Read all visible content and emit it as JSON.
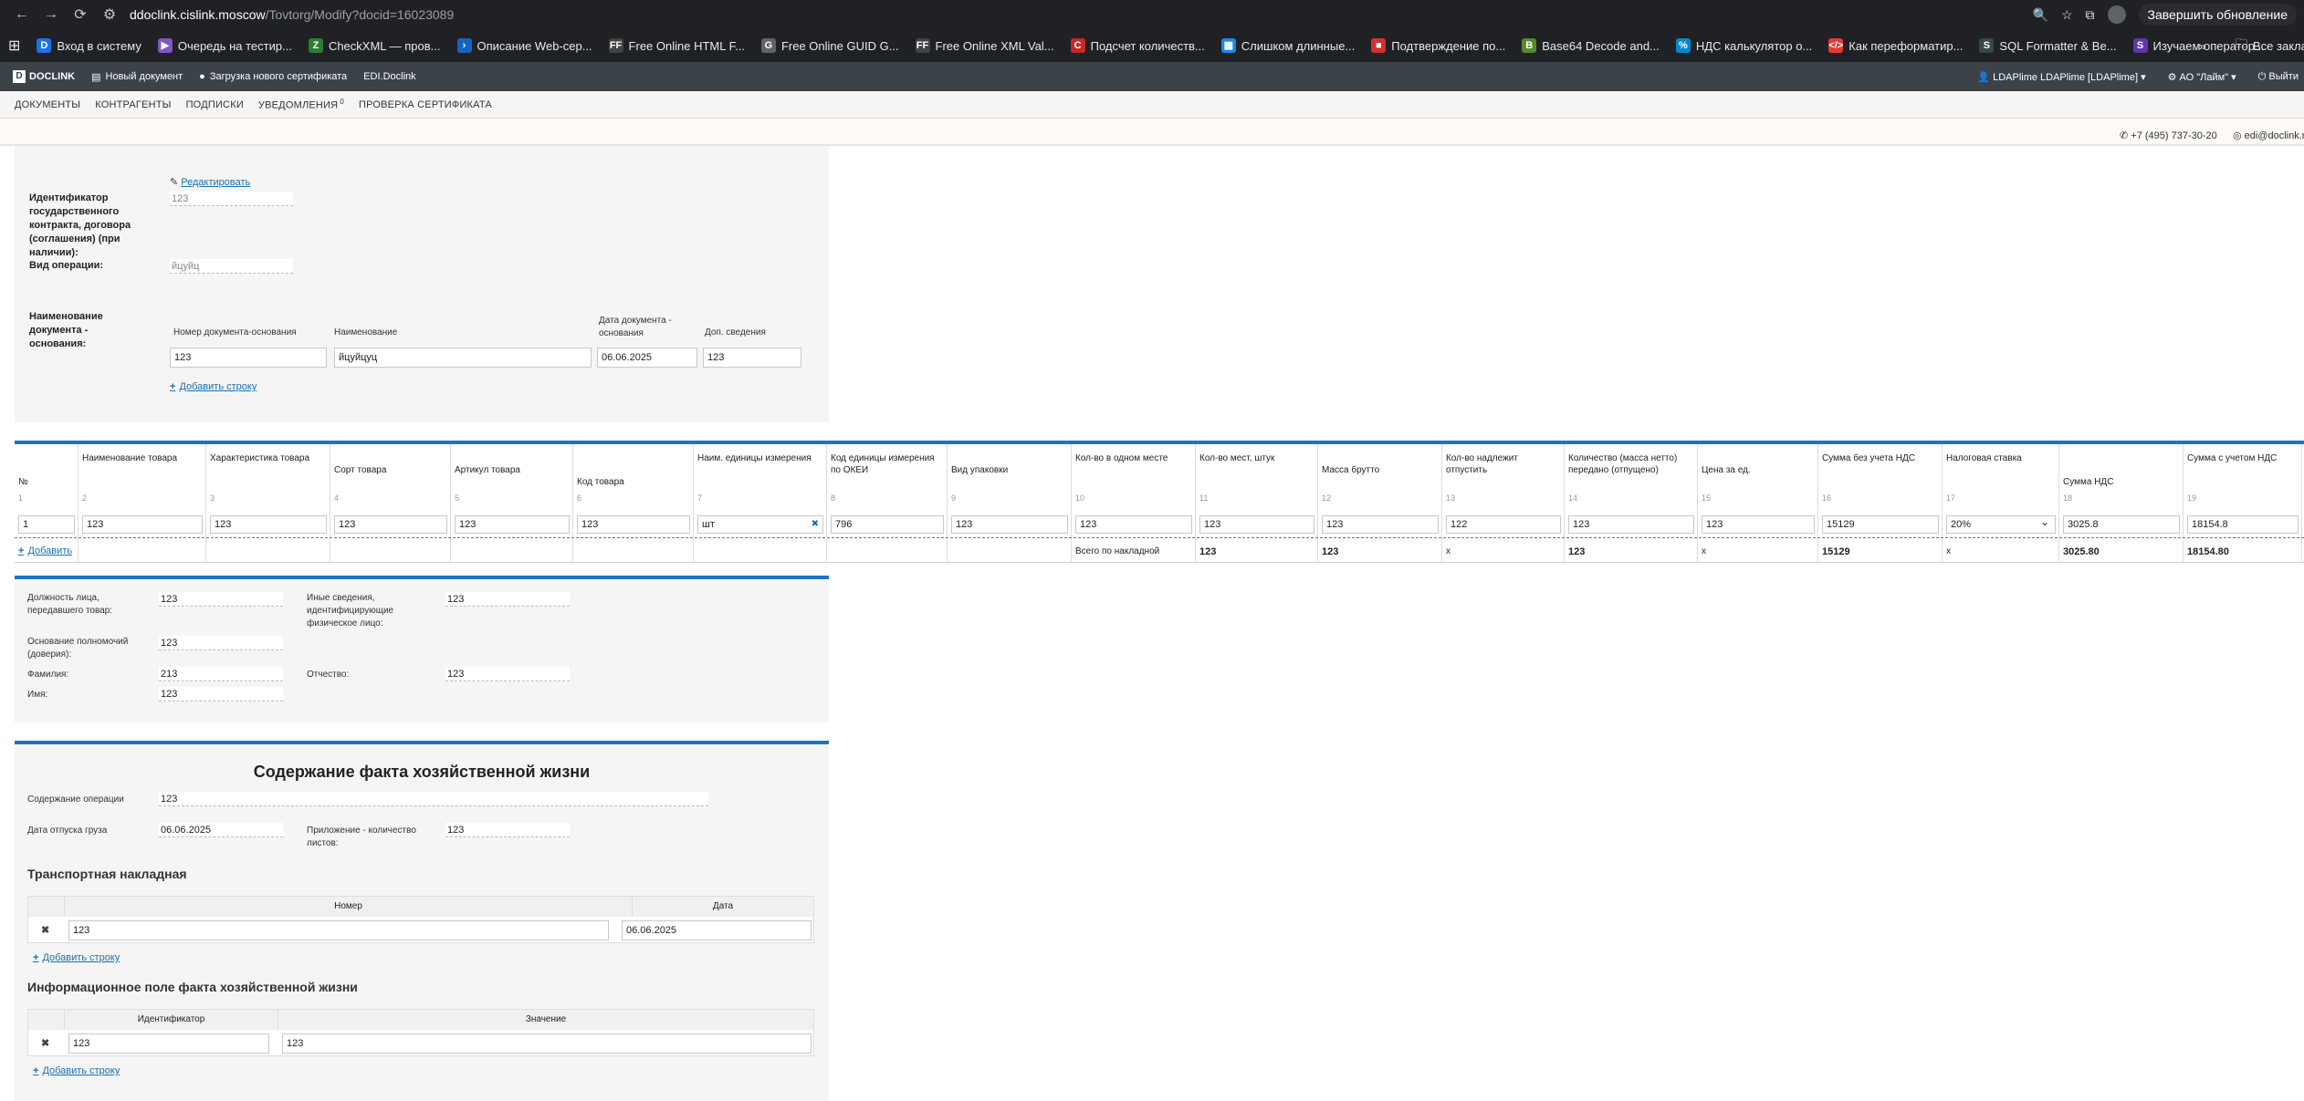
{
  "browser": {
    "url_host": "ddoclink.cislink.moscow",
    "url_path": "/Tovtorg/Modify?docid=16023089",
    "update_label": "Завершить обновление",
    "all_bookmarks_label": "Все закла",
    "bookmarks": [
      {
        "label": "Вход в систему",
        "color": "#1a73e8",
        "glyph": "D"
      },
      {
        "label": "Очередь на тестир...",
        "color": "#7e57c2",
        "glyph": "▶"
      },
      {
        "label": "CheckXML — пров...",
        "color": "#2e7d32",
        "glyph": "Z"
      },
      {
        "label": "Описание Web-сер...",
        "color": "#1565c0",
        "glyph": "›"
      },
      {
        "label": "Free Online HTML F...",
        "color": "#424242",
        "glyph": "FF"
      },
      {
        "label": "Free Online GUID G...",
        "color": "#5f6368",
        "glyph": "G"
      },
      {
        "label": "Free Online XML Val...",
        "color": "#424242",
        "glyph": "FF"
      },
      {
        "label": "Подсчет количеств...",
        "color": "#c62828",
        "glyph": "C"
      },
      {
        "label": "Слишком длинные...",
        "color": "#1e88e5",
        "glyph": "▦"
      },
      {
        "label": "Подтверждение по...",
        "color": "#d32f2f",
        "glyph": "■"
      },
      {
        "label": "Base64 Decode and...",
        "color": "#558b2f",
        "glyph": "B"
      },
      {
        "label": "НДС калькулятор о...",
        "color": "#0288d1",
        "glyph": "%"
      },
      {
        "label": "Как переформатир...",
        "color": "#e53935",
        "glyph": "</>"
      },
      {
        "label": "SQL Formatter & Be...",
        "color": "#37474f",
        "glyph": "S"
      },
      {
        "label": "Изучаем оператор...",
        "color": "#5e35b1",
        "glyph": "S"
      }
    ]
  },
  "header": {
    "logo": "DOCLINK",
    "new_doc": "Новый документ",
    "load_cert": "Загрузка нового сертификата",
    "edi": "EDI.Doclink",
    "user": "LDAPlime LDAPlime [LDAPlime]",
    "org": "АО \"Лайм\"",
    "exit": "Выйти"
  },
  "menu": {
    "documents": "ДОКУМЕНТЫ",
    "contractors": "КОНТРАГЕНТЫ",
    "subscriptions": "ПОДПИСКИ",
    "notifications": "УВЕДОМЛЕНИЯ",
    "notifications_count": "0",
    "check_cert": "ПРОВЕРКА СЕРТИФИКАТА"
  },
  "contacts": {
    "phone": "+7 (495) 737-30-20",
    "email": "edi@doclink.ru"
  },
  "top_section": {
    "edit_link": "Редактировать",
    "gov_contract_label": "Идентификатор государственного контракта, договора (соглашения) (при наличии):",
    "gov_contract_value": "123",
    "operation_type_label": "Вид операции:",
    "operation_type_value": "йцуйц",
    "basis_label": "Наименование документа - основания:",
    "basis_headers": [
      "Номер документа-основания",
      "Наименование",
      "Дата документа - основания",
      "Доп. сведения"
    ],
    "basis_values": [
      "123",
      "йцуйцуц",
      "06.06.2025",
      "123"
    ],
    "add_row": "Добавить строку"
  },
  "goods": {
    "headers": [
      "№",
      "Наименование товара",
      "Характеристика товара",
      "Сорт товара",
      "Артикул товара",
      "Код товара",
      "Наим. единицы измерения",
      "Код единицы измерения по ОКЕИ",
      "Вид упаковки",
      "Кол-во в одном месте",
      "Кол-во мест, штук",
      "Масса брутто",
      "Кол-во надлежит отпустить",
      "Количество (масса нетто) передано (отпущено)",
      "Цена за ед.",
      "Сумма без учета НДС",
      "Налоговая ставка",
      "Сумма НДС",
      "Сумма с учетом НДС"
    ],
    "numbers": [
      "1",
      "2",
      "3",
      "4",
      "5",
      "6",
      "7",
      "8",
      "9",
      "10",
      "11",
      "12",
      "13",
      "14",
      "15",
      "16",
      "17",
      "18",
      "19"
    ],
    "row": [
      "1",
      "123",
      "123",
      "123",
      "123",
      "123",
      "шт",
      "796",
      "123",
      "123",
      "123",
      "123",
      "122",
      "123",
      "123",
      "15129",
      "20%",
      "3025.8",
      "18154.8"
    ],
    "add_label": "Добавить",
    "totals_label": "Всего по накладной",
    "totals": {
      "places": "123",
      "gross": "123",
      "qty_release": "х",
      "qty_net": "123",
      "price": "х",
      "sum_wo_vat": "15129",
      "tax_rate": "х",
      "vat": "3025.80",
      "sum_with_vat": "18154.80"
    }
  },
  "person": {
    "position_label": "Должность лица, передавшего товар:",
    "position_value": "123",
    "other_label": "Иные сведения, идентифицирующие физическое лицо:",
    "other_value": "123",
    "authority_label": "Основание полномочий (доверия):",
    "authority_value": "123",
    "surname_label": "Фамилия:",
    "surname_value": "213",
    "patronymic_label": "Отчество:",
    "patronymic_value": "123",
    "name_label": "Имя:",
    "name_value": "123"
  },
  "fact": {
    "title": "Содержание факта хозяйственной жизни",
    "content_label": "Содержание операции",
    "content_value": "123",
    "ship_date_label": "Дата отпуска груза",
    "ship_date_value": "06.06.2025",
    "appendix_label": "Приложение - количество листов:",
    "appendix_value": "123",
    "waybill_title": "Транспортная накладная",
    "waybill_headers": [
      "Номер",
      "Дата"
    ],
    "waybill_row": [
      "123",
      "06.06.2025"
    ],
    "add_row": "Добавить строку",
    "info_title": "Информационное поле факта хозяйственной жизни",
    "info_headers": [
      "Идентификатор",
      "Значение"
    ],
    "info_row": [
      "123",
      "123"
    ],
    "add_row2": "Добавить строку"
  }
}
